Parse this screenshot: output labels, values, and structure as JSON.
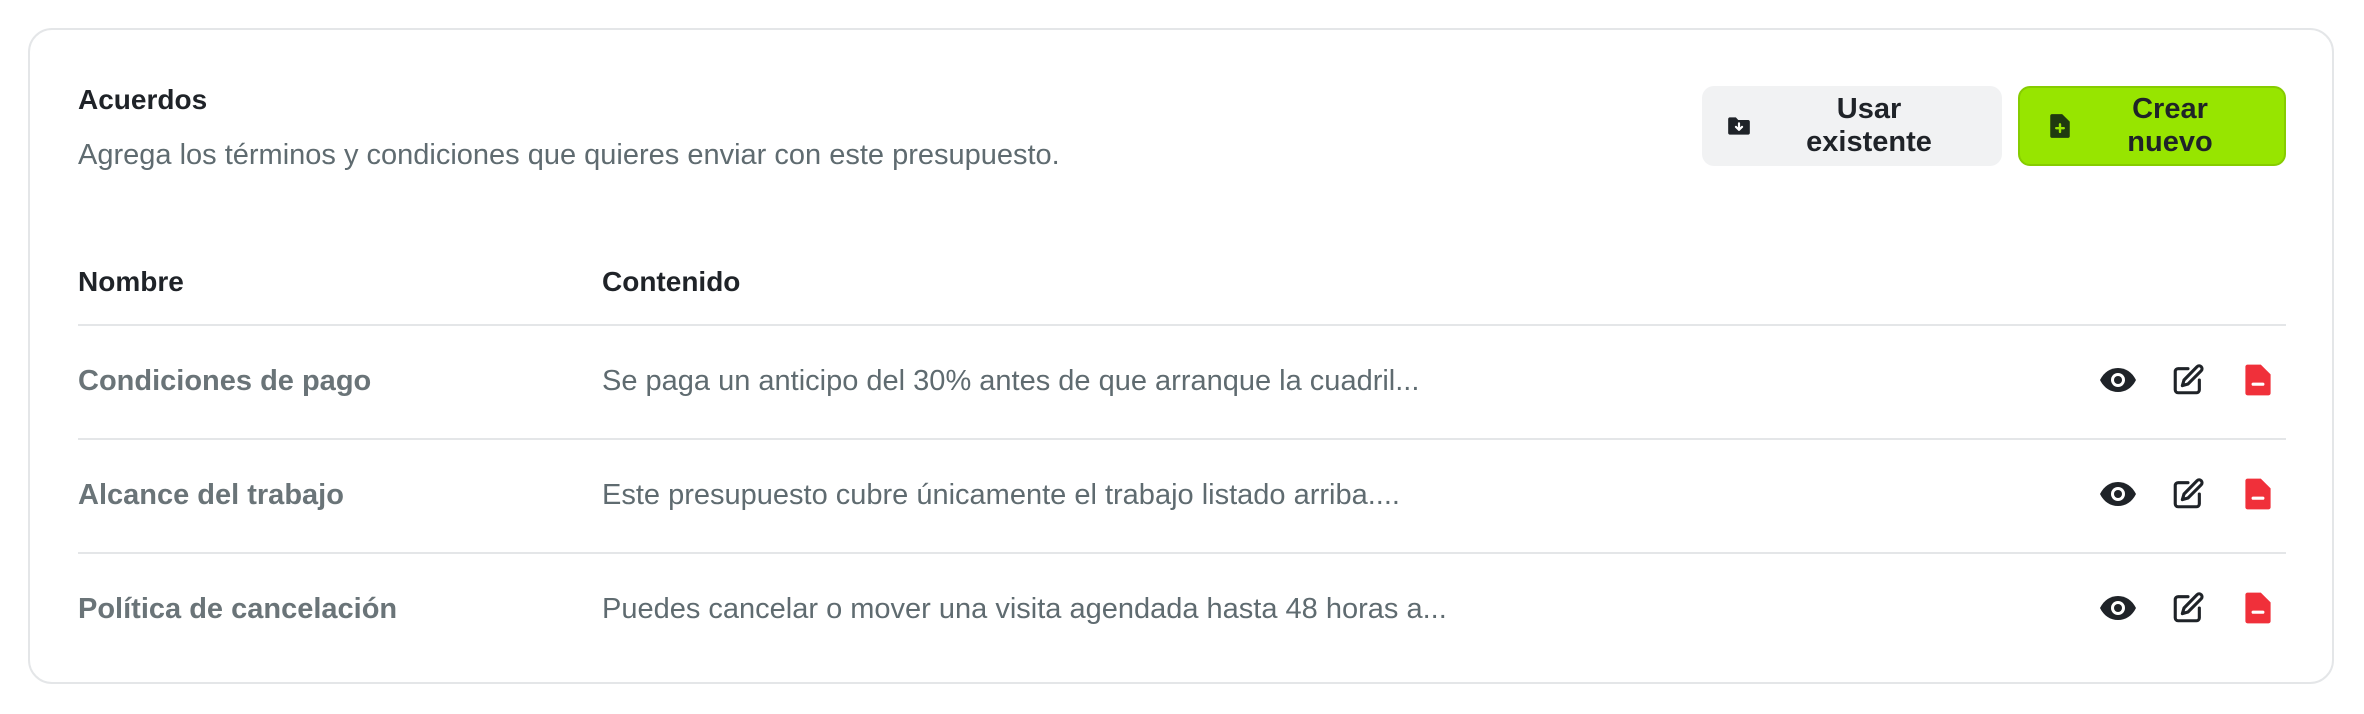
{
  "section": {
    "title": "Acuerdos",
    "description": "Agrega los términos y condiciones que quieres enviar con este presupuesto."
  },
  "buttons": {
    "use_existing": {
      "label": "Usar existente",
      "icon": "folder-download-icon"
    },
    "create_new": {
      "label": "Crear nuevo",
      "icon": "file-plus-icon"
    }
  },
  "table": {
    "headers": {
      "name": "Nombre",
      "content": "Contenido"
    },
    "rows": [
      {
        "name": "Condiciones de pago",
        "content": "Se paga un anticipo del 30% antes de que arranque la cuadril..."
      },
      {
        "name": "Alcance del trabajo",
        "content": "Este presupuesto cubre únicamente el trabajo listado arriba...."
      },
      {
        "name": "Política de cancelación",
        "content": "Puedes cancelar o mover una visita agendada hasta 48 horas a..."
      }
    ],
    "row_actions": [
      "eye-icon",
      "edit-icon",
      "file-minus-icon"
    ]
  },
  "colors": {
    "accent": "#97e500",
    "danger": "#f0303a",
    "text": "#1f2328",
    "muted": "#5f6b70",
    "border": "#e4e6e8"
  }
}
